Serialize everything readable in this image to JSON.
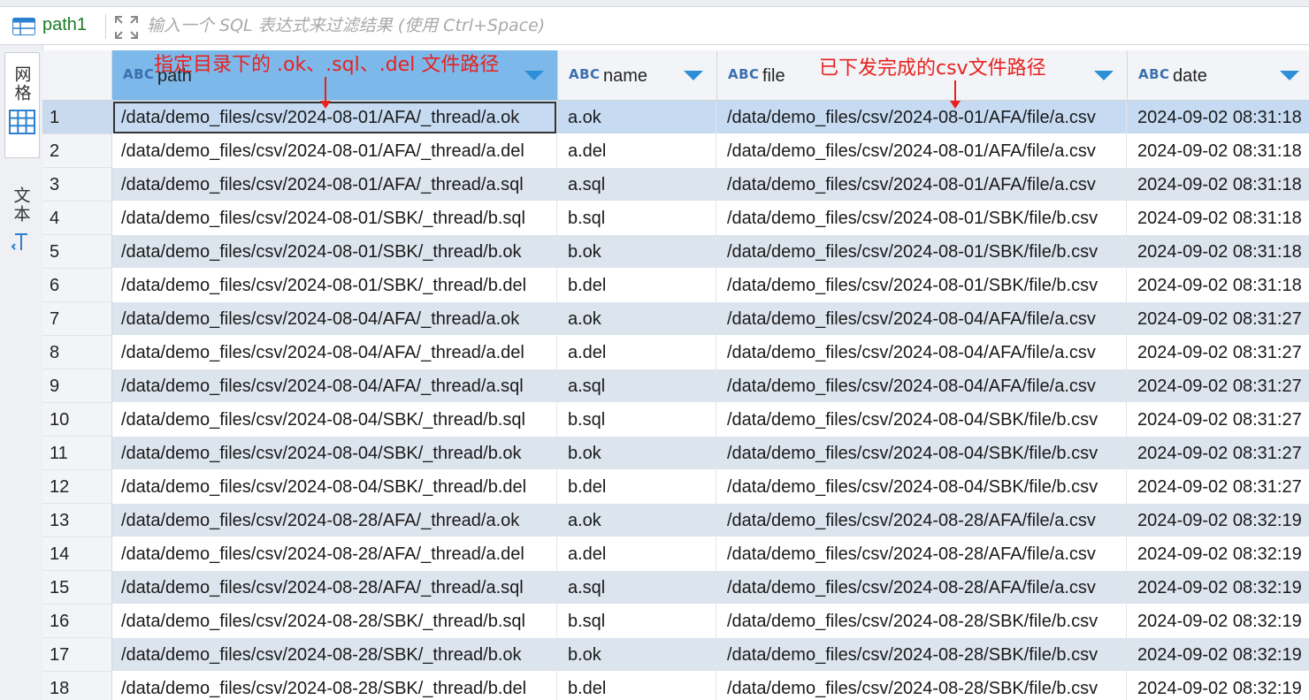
{
  "toolbar": {
    "tab_title": "path1",
    "filter_placeholder": "输入一个 SQL 表达式来过滤结果 (使用 Ctrl+Space)"
  },
  "sidebar": {
    "grid_label": "网格",
    "text_label": "文本"
  },
  "columns": [
    {
      "type": "ABC",
      "name": "path"
    },
    {
      "type": "ABC",
      "name": "name"
    },
    {
      "type": "ABC",
      "name": "file"
    },
    {
      "type": "ABC",
      "name": "date"
    }
  ],
  "rows": [
    {
      "n": "1",
      "path": "/data/demo_files/csv/2024-08-01/AFA/_thread/a.ok",
      "name": "a.ok",
      "file": "/data/demo_files/csv/2024-08-01/AFA/file/a.csv",
      "date": "2024-09-02 08:31:18"
    },
    {
      "n": "2",
      "path": "/data/demo_files/csv/2024-08-01/AFA/_thread/a.del",
      "name": "a.del",
      "file": "/data/demo_files/csv/2024-08-01/AFA/file/a.csv",
      "date": "2024-09-02 08:31:18"
    },
    {
      "n": "3",
      "path": "/data/demo_files/csv/2024-08-01/AFA/_thread/a.sql",
      "name": "a.sql",
      "file": "/data/demo_files/csv/2024-08-01/AFA/file/a.csv",
      "date": "2024-09-02 08:31:18"
    },
    {
      "n": "4",
      "path": "/data/demo_files/csv/2024-08-01/SBK/_thread/b.sql",
      "name": "b.sql",
      "file": "/data/demo_files/csv/2024-08-01/SBK/file/b.csv",
      "date": "2024-09-02 08:31:18"
    },
    {
      "n": "5",
      "path": "/data/demo_files/csv/2024-08-01/SBK/_thread/b.ok",
      "name": "b.ok",
      "file": "/data/demo_files/csv/2024-08-01/SBK/file/b.csv",
      "date": "2024-09-02 08:31:18"
    },
    {
      "n": "6",
      "path": "/data/demo_files/csv/2024-08-01/SBK/_thread/b.del",
      "name": "b.del",
      "file": "/data/demo_files/csv/2024-08-01/SBK/file/b.csv",
      "date": "2024-09-02 08:31:18"
    },
    {
      "n": "7",
      "path": "/data/demo_files/csv/2024-08-04/AFA/_thread/a.ok",
      "name": "a.ok",
      "file": "/data/demo_files/csv/2024-08-04/AFA/file/a.csv",
      "date": "2024-09-02 08:31:27"
    },
    {
      "n": "8",
      "path": "/data/demo_files/csv/2024-08-04/AFA/_thread/a.del",
      "name": "a.del",
      "file": "/data/demo_files/csv/2024-08-04/AFA/file/a.csv",
      "date": "2024-09-02 08:31:27"
    },
    {
      "n": "9",
      "path": "/data/demo_files/csv/2024-08-04/AFA/_thread/a.sql",
      "name": "a.sql",
      "file": "/data/demo_files/csv/2024-08-04/AFA/file/a.csv",
      "date": "2024-09-02 08:31:27"
    },
    {
      "n": "10",
      "path": "/data/demo_files/csv/2024-08-04/SBK/_thread/b.sql",
      "name": "b.sql",
      "file": "/data/demo_files/csv/2024-08-04/SBK/file/b.csv",
      "date": "2024-09-02 08:31:27"
    },
    {
      "n": "11",
      "path": "/data/demo_files/csv/2024-08-04/SBK/_thread/b.ok",
      "name": "b.ok",
      "file": "/data/demo_files/csv/2024-08-04/SBK/file/b.csv",
      "date": "2024-09-02 08:31:27"
    },
    {
      "n": "12",
      "path": "/data/demo_files/csv/2024-08-04/SBK/_thread/b.del",
      "name": "b.del",
      "file": "/data/demo_files/csv/2024-08-04/SBK/file/b.csv",
      "date": "2024-09-02 08:31:27"
    },
    {
      "n": "13",
      "path": "/data/demo_files/csv/2024-08-28/AFA/_thread/a.ok",
      "name": "a.ok",
      "file": "/data/demo_files/csv/2024-08-28/AFA/file/a.csv",
      "date": "2024-09-02 08:32:19"
    },
    {
      "n": "14",
      "path": "/data/demo_files/csv/2024-08-28/AFA/_thread/a.del",
      "name": "a.del",
      "file": "/data/demo_files/csv/2024-08-28/AFA/file/a.csv",
      "date": "2024-09-02 08:32:19"
    },
    {
      "n": "15",
      "path": "/data/demo_files/csv/2024-08-28/AFA/_thread/a.sql",
      "name": "a.sql",
      "file": "/data/demo_files/csv/2024-08-28/AFA/file/a.csv",
      "date": "2024-09-02 08:32:19"
    },
    {
      "n": "16",
      "path": "/data/demo_files/csv/2024-08-28/SBK/_thread/b.sql",
      "name": "b.sql",
      "file": "/data/demo_files/csv/2024-08-28/SBK/file/b.csv",
      "date": "2024-09-02 08:32:19"
    },
    {
      "n": "17",
      "path": "/data/demo_files/csv/2024-08-28/SBK/_thread/b.ok",
      "name": "b.ok",
      "file": "/data/demo_files/csv/2024-08-28/SBK/file/b.csv",
      "date": "2024-09-02 08:32:19"
    },
    {
      "n": "18",
      "path": "/data/demo_files/csv/2024-08-28/SBK/_thread/b.del",
      "name": "b.del",
      "file": "/data/demo_files/csv/2024-08-28/SBK/file/b.csv",
      "date": "2024-09-02 08:32:19"
    }
  ],
  "annotations": {
    "path_note": "指定目录下的 .ok、.sql、.del 文件路径",
    "file_note": "已下发完成的csv文件路径"
  },
  "colors": {
    "annotation": "#e8211f",
    "selected_header": "#7cb9ea",
    "odd_row": "#dce4ee",
    "sort_icon": "#2d8fd8"
  }
}
